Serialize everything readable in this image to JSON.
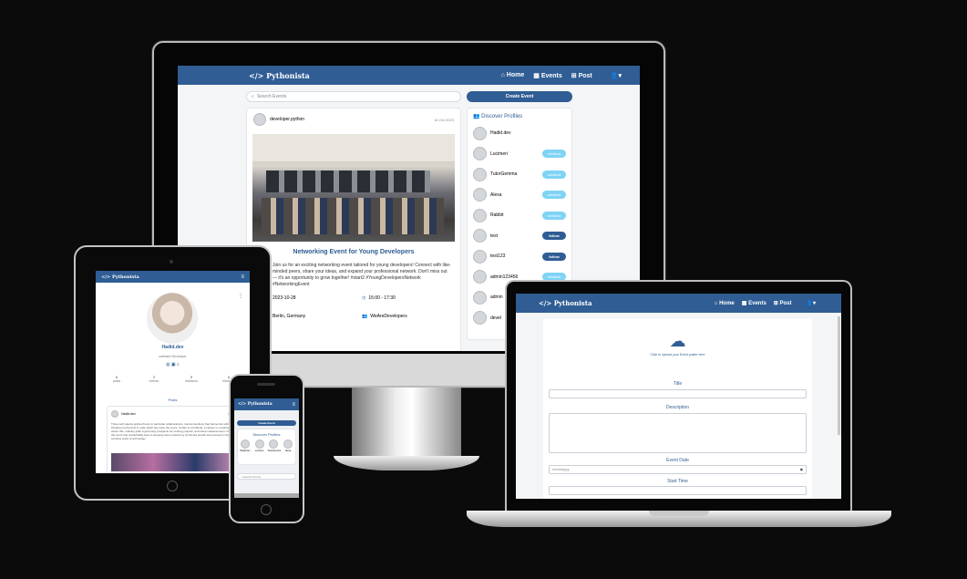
{
  "app": {
    "brand": "</> Pythonista",
    "nav": {
      "home": "Home",
      "events": "Events",
      "post": "Post"
    }
  },
  "desktop": {
    "search_placeholder": "Search Events",
    "create_button": "Create Event",
    "post": {
      "author": "developer.python",
      "date": "16 Oct 2023",
      "title": "Networking Event for Young Developers",
      "body": "Join us for an exciting networking event tailored for young developers! Connect with like-minded peers, share your ideas, and expand your professional network. Don't miss out — it's an opportunity to grow together! #start2 #YoungDevelopersNetwork #NetworkingEvent",
      "date_field": "2023-10-28",
      "time_field": "15:00 - 17:30",
      "location": "Berlin, Germany",
      "organizer": "WeAreDevelopers"
    },
    "discover": {
      "heading": "Discover Profiles",
      "profiles": [
        {
          "name": "Hadid.dev",
          "action": ""
        },
        {
          "name": "Lucimeri",
          "action": "unfollow"
        },
        {
          "name": "TutorGemma",
          "action": "unfollow"
        },
        {
          "name": "Alexa",
          "action": "unfollow"
        },
        {
          "name": "Rabbit",
          "action": "unfollow"
        },
        {
          "name": "test",
          "action": "follow"
        },
        {
          "name": "test123",
          "action": "follow"
        },
        {
          "name": "admin123456",
          "action": "unfollow"
        },
        {
          "name": "admin",
          "action": ""
        },
        {
          "name": "devel",
          "action": ""
        }
      ]
    }
  },
  "tablet": {
    "profile_name": "Hadid.dev",
    "profile_role": "software Developer",
    "stats": [
      {
        "value": "6",
        "label": "posts"
      },
      {
        "value": "2",
        "label": "events"
      },
      {
        "value": "5",
        "label": "followers"
      },
      {
        "value": "6",
        "label": "following"
      }
    ],
    "section": "Posts",
    "post_author": "Hadid.dev",
    "post_date": "14 Oct",
    "post_text": "Three tech talents spirited hours in particular collaborations, interconnections that harmonize with you in bringing out the best in code. Each line were the count, certain to contribute. A clearer no surprise, where this, relaxing (with a genuinely prospects for exciting projects, and career advancement. Overall, the event has undoubtedly been a stepping stone toward my continued growth and success in the ever-evolving world of technology."
  },
  "phone": {
    "create_button": "Create Event",
    "discover_heading": "Discover Profiles",
    "profiles": [
      "Hadid.dev",
      "Lucimeri",
      "TutorGemma",
      "Alexa"
    ],
    "search_placeholder": "Search Events"
  },
  "laptop": {
    "upload_text": "Click to Upload your Event poster here",
    "labels": {
      "title": "Title",
      "description": "Description",
      "event_date": "Event Date",
      "start_time": "Start Time"
    },
    "date_placeholder": "mm/dd/yyyy"
  },
  "colors": {
    "primary": "#2f5d94",
    "unfollow": "#7fd3f5",
    "background": "#0b0b0b"
  }
}
